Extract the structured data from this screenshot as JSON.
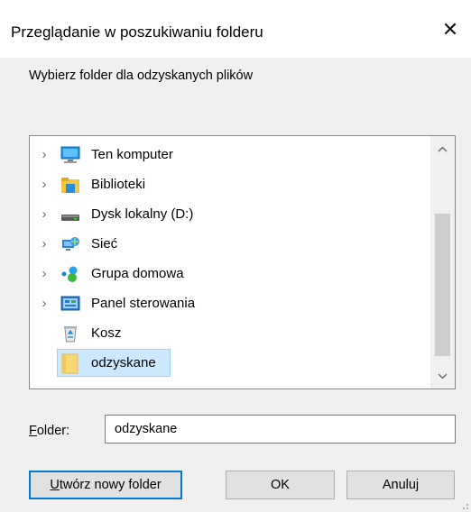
{
  "dialog": {
    "title": "Przeglądanie w poszukiwaniu folderu",
    "close_glyph": "✕",
    "instruction": "Wybierz folder dla odzyskanych plików"
  },
  "tree": {
    "items": [
      {
        "label": "Ten komputer",
        "icon": "computer-icon",
        "expandable": true
      },
      {
        "label": "Biblioteki",
        "icon": "libraries-icon",
        "expandable": true
      },
      {
        "label": "Dysk lokalny (D:)",
        "icon": "drive-icon",
        "expandable": true
      },
      {
        "label": "Sieć",
        "icon": "network-icon",
        "expandable": true
      },
      {
        "label": "Grupa domowa",
        "icon": "homegroup-icon",
        "expandable": true
      },
      {
        "label": "Panel sterowania",
        "icon": "control-panel-icon",
        "expandable": true
      },
      {
        "label": "Kosz",
        "icon": "recycle-bin-icon",
        "expandable": false
      },
      {
        "label": "odzyskane",
        "icon": "folder-icon",
        "expandable": false,
        "selected": true
      }
    ],
    "expander_glyph": "›"
  },
  "folder": {
    "label_access": "F",
    "label_rest": "older:",
    "value": "odzyskane"
  },
  "buttons": {
    "new_folder_access": "U",
    "new_folder_rest": "twórz nowy folder",
    "ok": "OK",
    "cancel": "Anuluj"
  },
  "colors": {
    "selection_bg": "#cce8ff",
    "selection_border": "#99d1ff",
    "default_button_border": "#0078d7",
    "dialog_bg": "#f0f0f0"
  }
}
